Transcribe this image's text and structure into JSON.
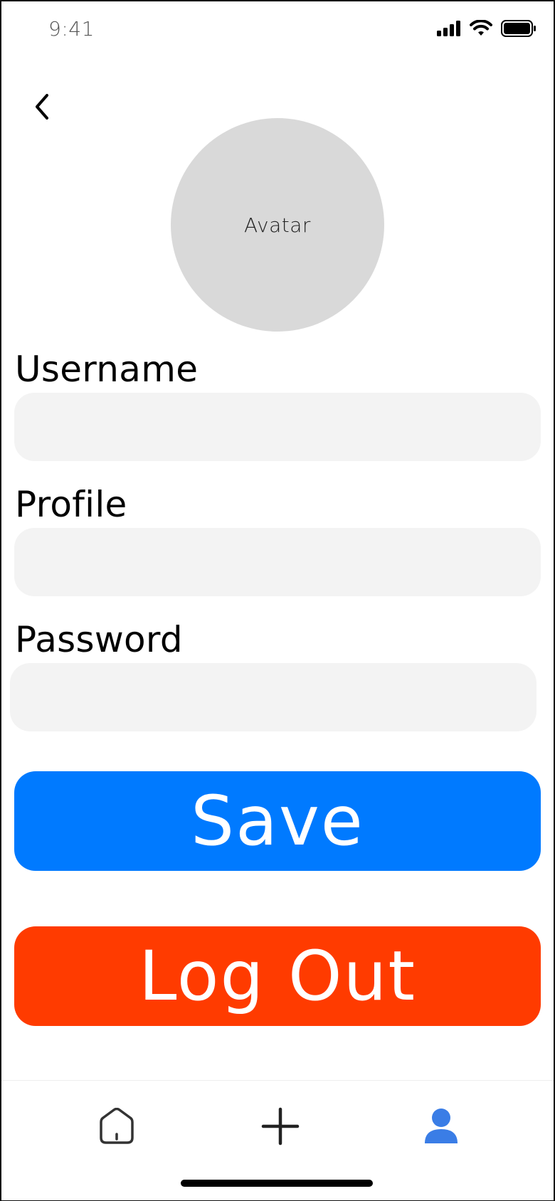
{
  "status_bar": {
    "time": "9:41"
  },
  "avatar": {
    "label": "Avatar"
  },
  "form": {
    "username_label": "Username",
    "username_value": "",
    "profile_label": "Profile",
    "profile_value": "",
    "password_label": "Password",
    "password_value": ""
  },
  "buttons": {
    "save_label": "Save",
    "logout_label": "Log Out"
  },
  "tab_bar": {
    "items": [
      {
        "icon": "home-icon",
        "active": false
      },
      {
        "icon": "plus-icon",
        "active": false
      },
      {
        "icon": "person-icon",
        "active": true
      }
    ]
  },
  "colors": {
    "save": "#007aff",
    "logout": "#ff3b00",
    "active_tab": "#3a7de6",
    "input_bg": "#f3f3f3",
    "avatar_bg": "#d9d9d9"
  }
}
